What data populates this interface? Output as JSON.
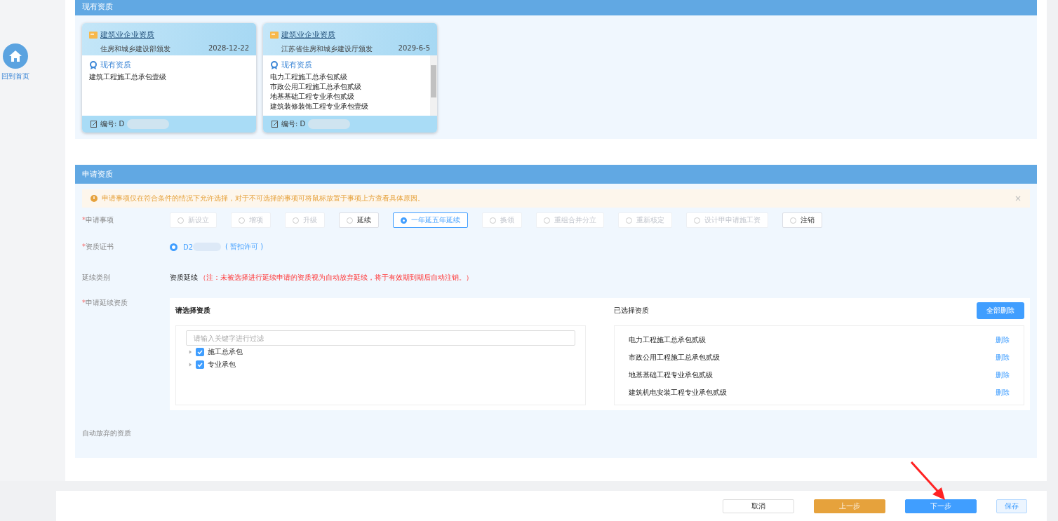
{
  "sidebar": {
    "home_label": "回到首页"
  },
  "existing_section": {
    "title": "现有资质",
    "cards": [
      {
        "kind": "plain",
        "title": "建筑业企业资质",
        "issuer": "住房和城乡建设部颁发",
        "date": "2028-12-22",
        "heading": "现有资质",
        "items": [
          "建筑工程施工总承包壹级"
        ],
        "number": "编号: D"
      },
      {
        "kind": "scroll",
        "title": "建筑业企业资质",
        "issuer": "江苏省住房和城乡建设厅颁发",
        "date": "2029-6-5",
        "heading": "现有资质",
        "items": [
          "电力工程施工总承包贰级",
          "市政公用工程施工总承包贰级",
          "地基基础工程专业承包贰级",
          "建筑装修装饰工程专业承包壹级"
        ],
        "number": "编号: D"
      }
    ]
  },
  "apply_section": {
    "title": "申请资质",
    "alert": "申请事项仅在符合条件的情况下允许选择，对于不可选择的事项可将鼠标放置于事项上方查看具体原因。",
    "alert_close": "×",
    "matter": {
      "label": "申请事项",
      "marker": "*",
      "options": [
        {
          "label": "新设立",
          "selected": false,
          "disabled": true
        },
        {
          "label": "增项",
          "selected": false,
          "disabled": true
        },
        {
          "label": "升级",
          "selected": false,
          "disabled": true
        },
        {
          "label": "延续",
          "selected": false,
          "disabled": false
        },
        {
          "label": "一年延五年延续",
          "selected": true,
          "disabled": false
        },
        {
          "label": "换领",
          "selected": false,
          "disabled": true
        },
        {
          "label": "重组合并分立",
          "selected": false,
          "disabled": true
        },
        {
          "label": "重新核定",
          "selected": false,
          "disabled": true
        },
        {
          "label": "设计甲申请施工资",
          "selected": false,
          "disabled": true
        },
        {
          "label": "注销",
          "selected": false,
          "disabled": false
        }
      ]
    },
    "certificate": {
      "label": "资质证书",
      "marker": "*",
      "selected": true,
      "value": "D2",
      "status": "( 暂扣许可 )"
    },
    "category": {
      "label": "延续类别",
      "value": "资质延续",
      "note": "（注：未被选择进行延续申请的资质视为自动放弃延续，将于有效期到期后自动注销。）"
    },
    "renew": {
      "label": "申请延续资质",
      "marker": "*",
      "left": {
        "title": "请选择资质",
        "placeholder": "请输入关键字进行过滤",
        "tree": [
          {
            "label": "施工总承包",
            "checked": true,
            "expanded": false
          },
          {
            "label": "专业承包",
            "checked": true,
            "expanded": false
          }
        ]
      },
      "right": {
        "title": "已选择资质",
        "clear_button": "全部删除",
        "items": [
          {
            "label": "电力工程施工总承包贰级",
            "action": "删除"
          },
          {
            "label": "市政公用工程施工总承包贰级",
            "action": "删除"
          },
          {
            "label": "地基基础工程专业承包贰级",
            "action": "删除"
          },
          {
            "label": "建筑机电安装工程专业承包贰级",
            "action": "删除"
          }
        ]
      }
    },
    "abandoned": {
      "label": "自动放弃的资质"
    }
  },
  "footer": {
    "buttons": [
      {
        "label": "取消",
        "kind": "plain"
      },
      {
        "label": "上一步",
        "kind": "warning"
      },
      {
        "label": "下一步",
        "kind": "primary"
      },
      {
        "label": "保存",
        "kind": "light"
      }
    ]
  }
}
